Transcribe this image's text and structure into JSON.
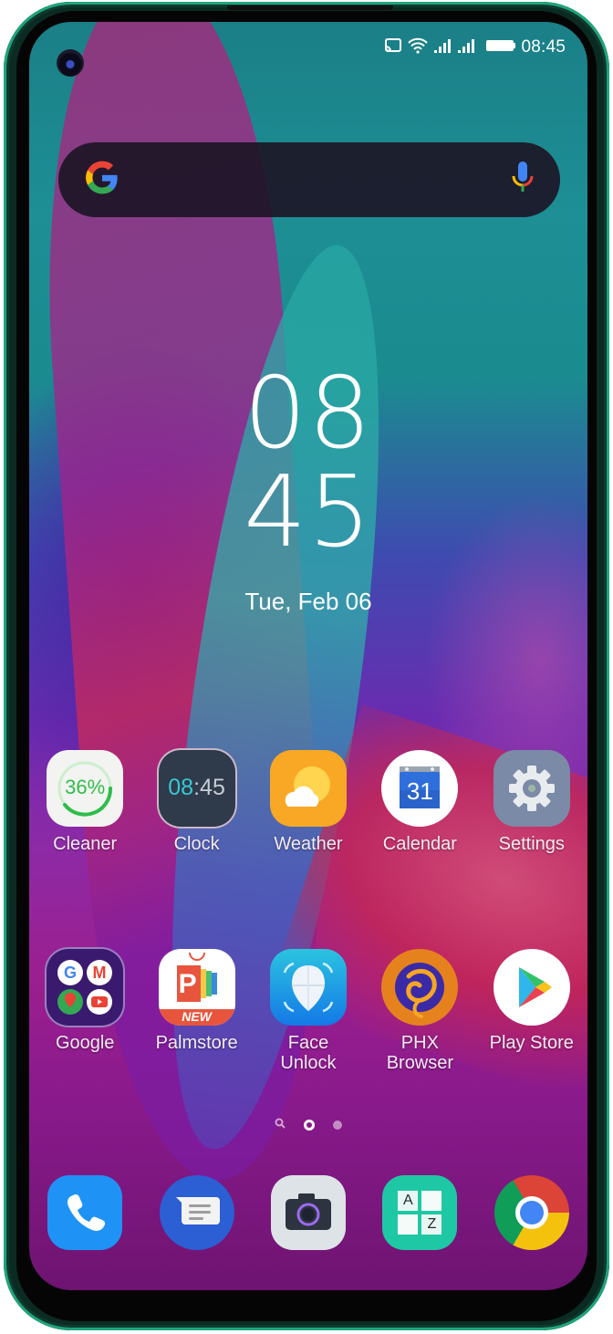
{
  "status_bar": {
    "time": "08:45",
    "icons": [
      "cast-icon",
      "wifi-icon",
      "signal-icon",
      "signal-icon",
      "battery-icon"
    ]
  },
  "search_widget": {
    "logo": "G",
    "logo_icon": "google-logo-icon",
    "mic_icon": "microphone-icon"
  },
  "clock_widget": {
    "hour": "08",
    "minute": "45",
    "date": "Tue, Feb 06"
  },
  "home_apps": {
    "row1": [
      {
        "label": "Cleaner",
        "icon": "cleaner-icon",
        "badge": "36%"
      },
      {
        "label": "Clock",
        "icon": "clock-icon",
        "time_hour": "08",
        "time_min": ":45"
      },
      {
        "label": "Weather",
        "icon": "weather-icon"
      },
      {
        "label": "Calendar",
        "icon": "calendar-icon",
        "day": "31"
      },
      {
        "label": "Settings",
        "icon": "settings-gear-icon"
      }
    ],
    "row2": [
      {
        "label": "Google",
        "icon": "google-folder-icon"
      },
      {
        "label": "Palmstore",
        "icon": "palmstore-icon",
        "badge": "NEW",
        "letter": "P"
      },
      {
        "label": "Face\nUnlock",
        "label_line1": "Face",
        "label_line2": "Unlock",
        "icon": "face-unlock-icon"
      },
      {
        "label": "PHX\nBrowser",
        "label_line1": "PHX",
        "label_line2": "Browser",
        "icon": "phx-browser-icon"
      },
      {
        "label": "Play Store",
        "icon": "play-store-icon"
      }
    ]
  },
  "page_indicator": {
    "pages": 3,
    "current_page": 2,
    "first_is_search": true
  },
  "dock": [
    {
      "name": "Phone",
      "icon": "phone-icon"
    },
    {
      "name": "Messages",
      "icon": "messages-icon"
    },
    {
      "name": "Camera",
      "icon": "camera-icon"
    },
    {
      "name": "A-Z Apps",
      "icon": "app-drawer-icon",
      "letter_a": "A",
      "letter_z": "Z"
    },
    {
      "name": "Chrome",
      "icon": "chrome-icon"
    }
  ],
  "colors": {
    "frame_green": "#1fa57c",
    "search_bg": "#1c1626",
    "google_blue": "#4285f4",
    "google_red": "#ea4335",
    "google_yellow": "#fbbc05",
    "google_green": "#34a853"
  }
}
